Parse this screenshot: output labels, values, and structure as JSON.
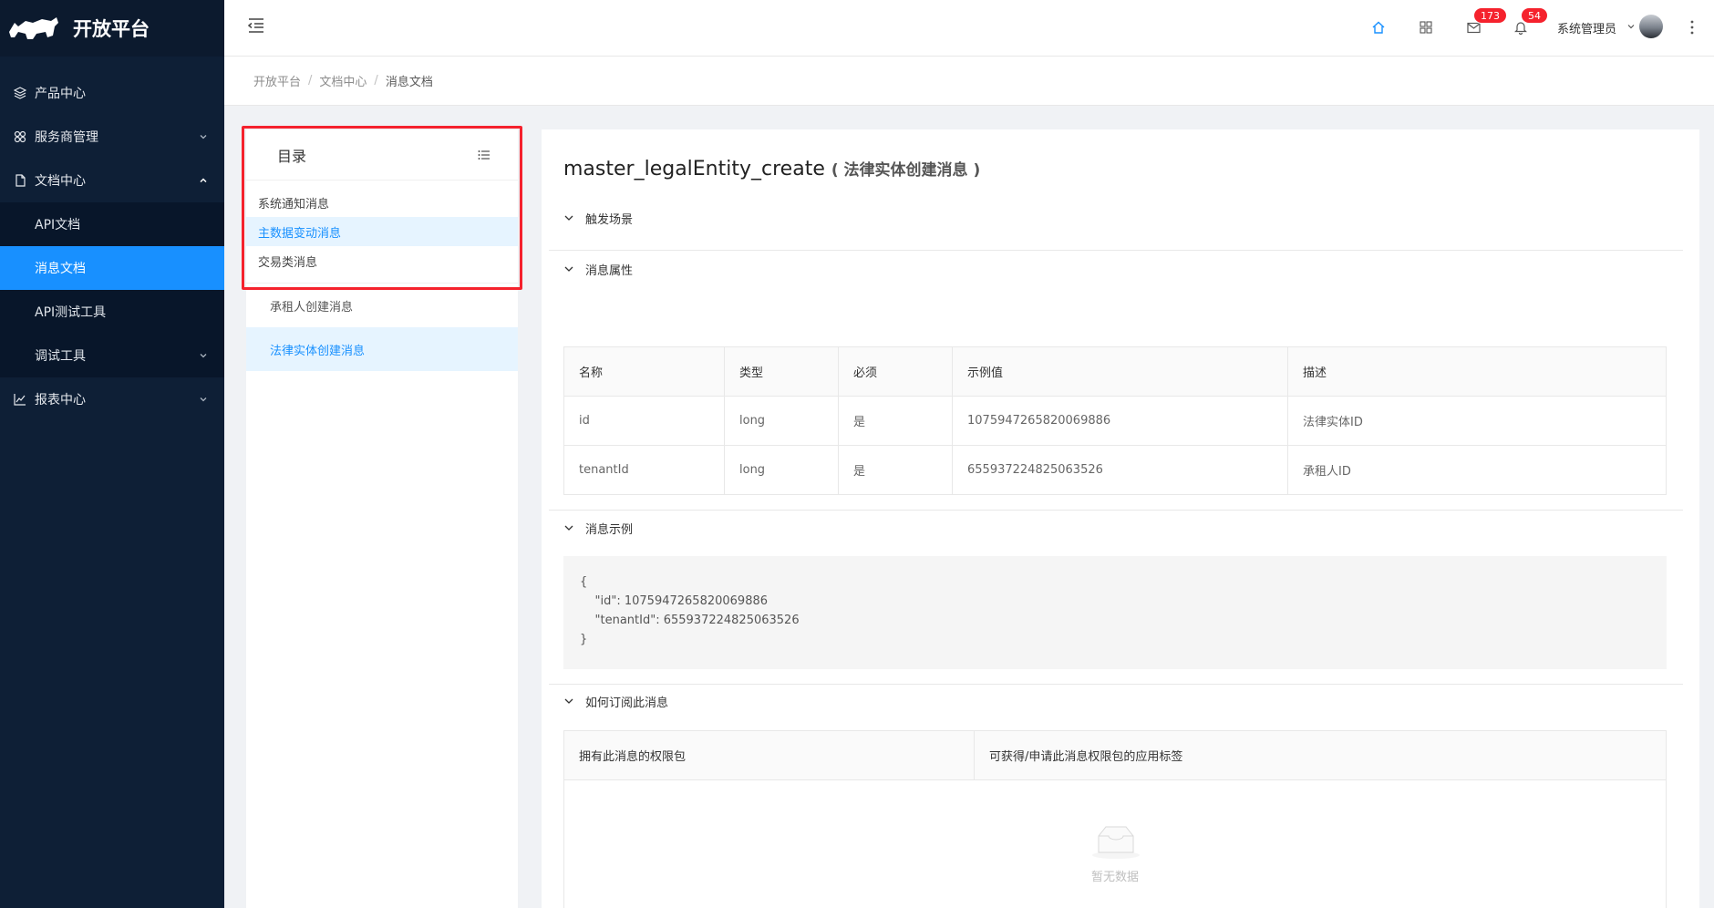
{
  "app": {
    "title": "开放平台"
  },
  "sidebar": {
    "items": [
      {
        "label": "产品中心",
        "icon": "layers-icon"
      },
      {
        "label": "服务商管理",
        "icon": "apps-icon"
      },
      {
        "label": "文档中心",
        "icon": "file-icon"
      },
      {
        "label": "报表中心",
        "icon": "chart-line-icon"
      }
    ],
    "doc_sub": [
      {
        "label": "API文档"
      },
      {
        "label": "消息文档"
      },
      {
        "label": "API测试工具"
      },
      {
        "label": "调试工具"
      }
    ]
  },
  "header": {
    "mail_badge": "173",
    "bell_badge": "54",
    "user_name": "系统管理员"
  },
  "breadcrumb": [
    "开放平台",
    "文档中心",
    "消息文档"
  ],
  "catalog": {
    "title": "目录",
    "groups": [
      "系统通知消息",
      "主数据变动消息",
      "交易类消息"
    ],
    "subs": [
      "承租人创建消息",
      "法律实体创建消息"
    ]
  },
  "doc": {
    "title": "master_legalEntity_create",
    "subtitle": "( 法律实体创建消息 )",
    "sections": {
      "trigger": "触发场景",
      "properties": "消息属性",
      "example": "消息示例",
      "subscribe": "如何订阅此消息"
    },
    "table_headers": [
      "名称",
      "类型",
      "必须",
      "示例值",
      "描述"
    ],
    "rows": [
      [
        "id",
        "long",
        "是",
        "1075947265820069886",
        "法律实体ID"
      ],
      [
        "tenantId",
        "long",
        "是",
        "655937224825063526",
        "承租人ID"
      ]
    ],
    "example_lines": [
      "{",
      "    \"id\": 1075947265820069886",
      "    \"tenantId\": 655937224825063526",
      "}"
    ],
    "subscribe_headers": [
      "拥有此消息的权限包",
      "可获得/申请此消息权限包的应用标签"
    ],
    "empty_text": "暂无数据"
  },
  "colors": {
    "primary": "#1890ff",
    "sidebar": "#0e1f36",
    "badge": "#f5222d",
    "highlight_box": "#f5222d"
  }
}
